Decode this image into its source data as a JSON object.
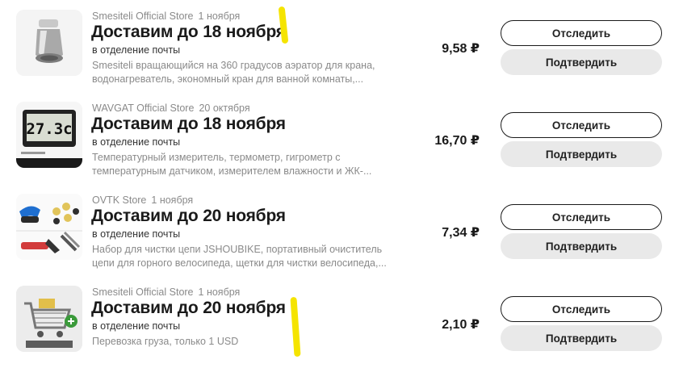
{
  "colors": {
    "accent_marker": "#f5e400",
    "secondary_button_bg": "#e9e9e9",
    "text_muted": "#8a8a8a"
  },
  "orders": [
    {
      "store": "Smesiteli Official Store",
      "order_date": "1 ноября",
      "delivery_title": "Доставим до 18 ноября",
      "pickup": "в отделение почты",
      "description": "Smesiteli вращающийся на 360 градусов аэратор для крана, водонагреватель, экономный кран для ванной комнаты,...",
      "price": "9,58 ₽",
      "track_label": "Отследить",
      "confirm_label": "Подтвердить",
      "thumb_icon": "faucet-aerator-icon"
    },
    {
      "store": "WAVGAT Official Store",
      "order_date": "20 октября",
      "delivery_title": "Доставим до 18 ноября",
      "pickup": "в отделение почты",
      "description": "Температурный измеритель, термометр, гигрометр с температурным датчиком, измерителем влажности и ЖК-...",
      "price": "16,70 ₽",
      "track_label": "Отследить",
      "confirm_label": "Подтвердить",
      "thumb_icon": "lcd-thermometer-icon",
      "thumb_text": "27.3c"
    },
    {
      "store": "OVTK Store",
      "order_date": "1 ноября",
      "delivery_title": "Доставим до 20 ноября",
      "pickup": "в отделение почты",
      "description": "Набор для чистки цепи JSHOUBIKE, портативный очиститель цепи для горного велосипеда, щетки для чистки велосипеда,...",
      "price": "7,34 ₽",
      "track_label": "Отследить",
      "confirm_label": "Подтвердить",
      "thumb_icon": "bike-cleaning-kit-icon"
    },
    {
      "store": "Smesiteli Official Store",
      "order_date": "1 ноября",
      "delivery_title": "Доставим до 20 ноября",
      "pickup": "в отделение почты",
      "description": "Перевозка груза, только 1 USD",
      "price": "2,10 ₽",
      "track_label": "Отследить",
      "confirm_label": "Подтвердить",
      "thumb_icon": "shopping-cart-icon"
    }
  ]
}
